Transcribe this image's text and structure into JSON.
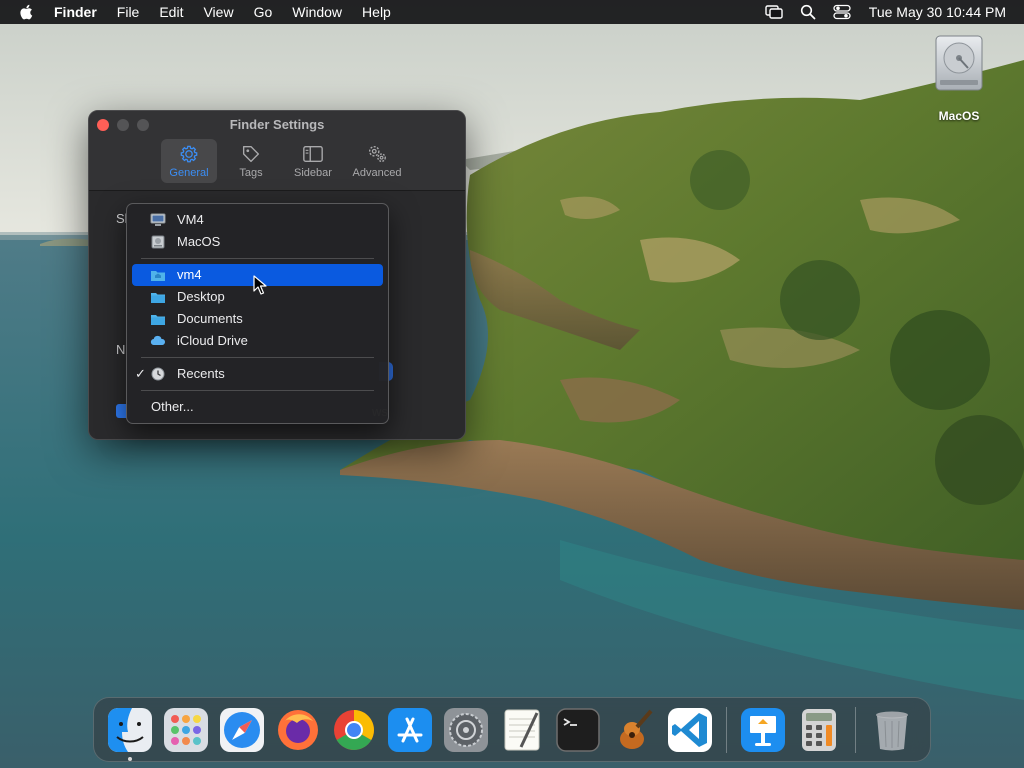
{
  "menubar": {
    "app_name": "Finder",
    "menus": [
      "File",
      "Edit",
      "View",
      "Go",
      "Window",
      "Help"
    ],
    "clock": "Tue May 30  10:44 PM",
    "status_icons": [
      "screen-mirroring-icon",
      "search-icon",
      "control-center-icon"
    ]
  },
  "desktop": {
    "icons": [
      {
        "label": "MacOS",
        "icon": "hard-disk-icon"
      }
    ]
  },
  "window": {
    "title": "Finder Settings",
    "tabs": [
      {
        "label": "General",
        "icon": "gear-icon",
        "active": true
      },
      {
        "label": "Tags",
        "icon": "tag-icon",
        "active": false
      },
      {
        "label": "Sidebar",
        "icon": "sidebar-icon",
        "active": false
      },
      {
        "label": "Advanced",
        "icon": "gears-icon",
        "active": false
      }
    ],
    "fragments": {
      "s": "Sl",
      "n": "N",
      "ws": "ws"
    }
  },
  "dropdown": {
    "items": [
      {
        "label": "VM4",
        "icon": "computer-icon"
      },
      {
        "label": "MacOS",
        "icon": "hard-disk-icon"
      },
      {
        "label": "vm4",
        "icon": "home-folder-icon",
        "selected": true
      },
      {
        "label": "Desktop",
        "icon": "folder-icon"
      },
      {
        "label": "Documents",
        "icon": "folder-icon"
      },
      {
        "label": "iCloud Drive",
        "icon": "cloud-icon"
      },
      {
        "label": "Recents",
        "icon": "clock-icon",
        "checked": true
      },
      {
        "label": "Other..."
      }
    ]
  },
  "dock": {
    "apps": [
      "Finder",
      "Launchpad",
      "Safari",
      "Firefox",
      "Chrome",
      "App Store",
      "System Settings",
      "TextEdit",
      "Terminal",
      "GarageBand",
      "Visual Studio Code",
      "Keynote",
      "Calculator",
      "Trash"
    ]
  },
  "colors": {
    "accent": "#0a5ae0",
    "tab_active": "#3b8ef5",
    "close": "#ff5f57"
  }
}
